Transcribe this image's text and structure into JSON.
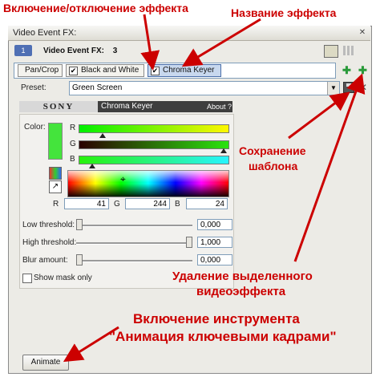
{
  "window": {
    "title": "Video Event FX:",
    "track_number": "1",
    "fx_label": "Video Event FX:",
    "fx_count": "3"
  },
  "fx_chain": [
    {
      "label": "Pan/Crop",
      "checked": false,
      "selected": false
    },
    {
      "label": "Black and White",
      "checked": true,
      "selected": false
    },
    {
      "label": "Chroma Keyer",
      "checked": true,
      "selected": true
    }
  ],
  "preset": {
    "label": "Preset:",
    "value": "Green Screen"
  },
  "plugin": {
    "vendor": "SONY",
    "name": "Chroma Keyer",
    "about": "About ?"
  },
  "color": {
    "label": "Color:",
    "swatch": "#44e43c",
    "channels": [
      {
        "name": "R",
        "value": 41,
        "max": 255
      },
      {
        "name": "G",
        "value": 244,
        "max": 255
      },
      {
        "name": "B",
        "value": 24,
        "max": 255
      }
    ]
  },
  "params": [
    {
      "label": "Low threshold:",
      "value": "0,000",
      "fraction": 0.0
    },
    {
      "label": "High threshold:",
      "value": "1,000",
      "fraction": 1.0
    },
    {
      "label": "Blur amount:",
      "value": "0,000",
      "fraction": 0.0
    }
  ],
  "show_mask": {
    "label": "Show mask only",
    "checked": false
  },
  "animate_label": "Animate",
  "annotations": {
    "toggle_effect": "Включение/отключение эффекта",
    "effect_name": "Название эффекта",
    "save_preset_1": "Сохранение",
    "save_preset_2": "шаблона",
    "delete_effect_1": "Удаление выделенного",
    "delete_effect_2": "видеоэффекта",
    "keyframe_1": "Включение инструмента",
    "keyframe_2": "\"Анимация ключевыми кадрами\""
  },
  "colors": {
    "annotation": "#cc0000",
    "accent_green": "#2a9a3a"
  }
}
